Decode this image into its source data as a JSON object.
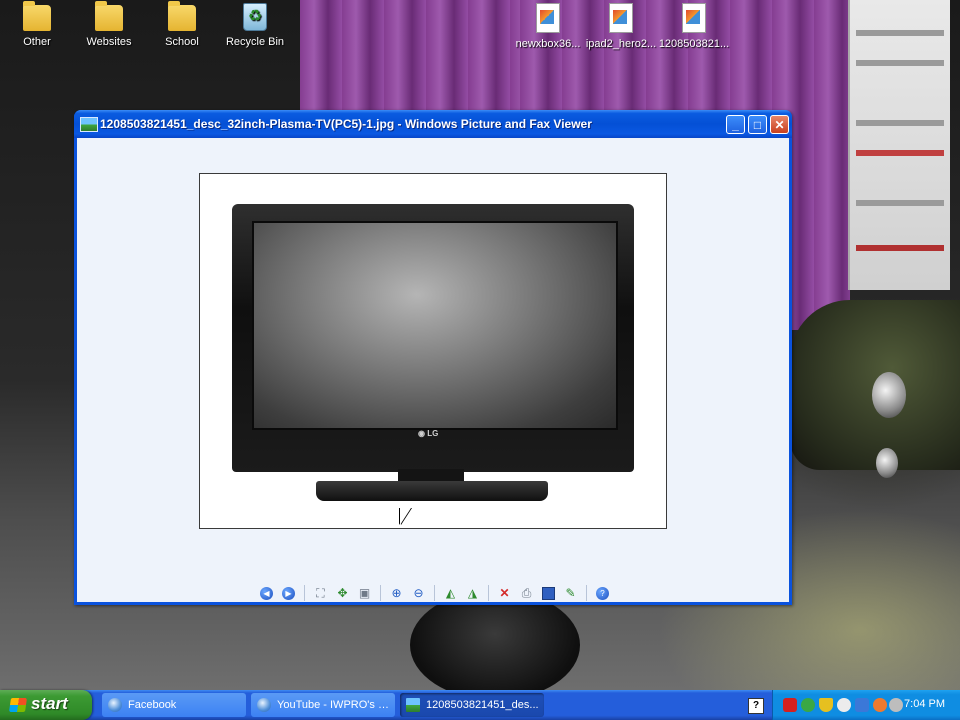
{
  "desktop": {
    "icons": [
      {
        "label": "Other",
        "type": "folder"
      },
      {
        "label": "Websites",
        "type": "folder"
      },
      {
        "label": "School",
        "type": "folder"
      },
      {
        "label": "Recycle Bin",
        "type": "recycle-bin"
      },
      {
        "label": "newxbox36...",
        "type": "image-file"
      },
      {
        "label": "ipad2_hero2...",
        "type": "image-file"
      },
      {
        "label": "1208503821...",
        "type": "image-file"
      }
    ]
  },
  "window": {
    "title": "1208503821451_desc_32inch-Plasma-TV(PC5)-1.jpg - Windows Picture and Fax Viewer",
    "minimize_glyph": "_",
    "maximize_glyph": "□",
    "close_glyph": "✕",
    "image": {
      "subject": "LG flat-screen television",
      "brand_text": "◉ LG"
    },
    "toolbar": [
      {
        "name": "previous-image",
        "glyph": "⏮"
      },
      {
        "name": "next-image",
        "glyph": "⏭"
      },
      {
        "name": "best-fit",
        "glyph": "⛶"
      },
      {
        "name": "actual-size",
        "glyph": "✥"
      },
      {
        "name": "slide-show",
        "glyph": "▣"
      },
      {
        "name": "zoom-in",
        "glyph": "⊕"
      },
      {
        "name": "zoom-out",
        "glyph": "⊖"
      },
      {
        "name": "rotate-clockwise",
        "glyph": "◭"
      },
      {
        "name": "rotate-counterclockwise",
        "glyph": "◮"
      },
      {
        "name": "delete",
        "glyph": "✕"
      },
      {
        "name": "print",
        "glyph": "⎙"
      },
      {
        "name": "copy-to",
        "glyph": "💾"
      },
      {
        "name": "close-and-open-editor",
        "glyph": "✎"
      },
      {
        "name": "help",
        "glyph": "?"
      }
    ]
  },
  "taskbar": {
    "start_label": "start",
    "tasks": [
      {
        "label": "Facebook",
        "active": false
      },
      {
        "label": "YouTube - IWPRO's C...",
        "active": false
      },
      {
        "label": "1208503821451_des...",
        "active": true
      }
    ],
    "help_glyph": "?",
    "clock": "7:04 PM"
  },
  "colors": {
    "titlebar": "#0450d6",
    "taskbar": "#245edb",
    "start_button": "#3c9a33",
    "tray": "#0f8de2"
  }
}
